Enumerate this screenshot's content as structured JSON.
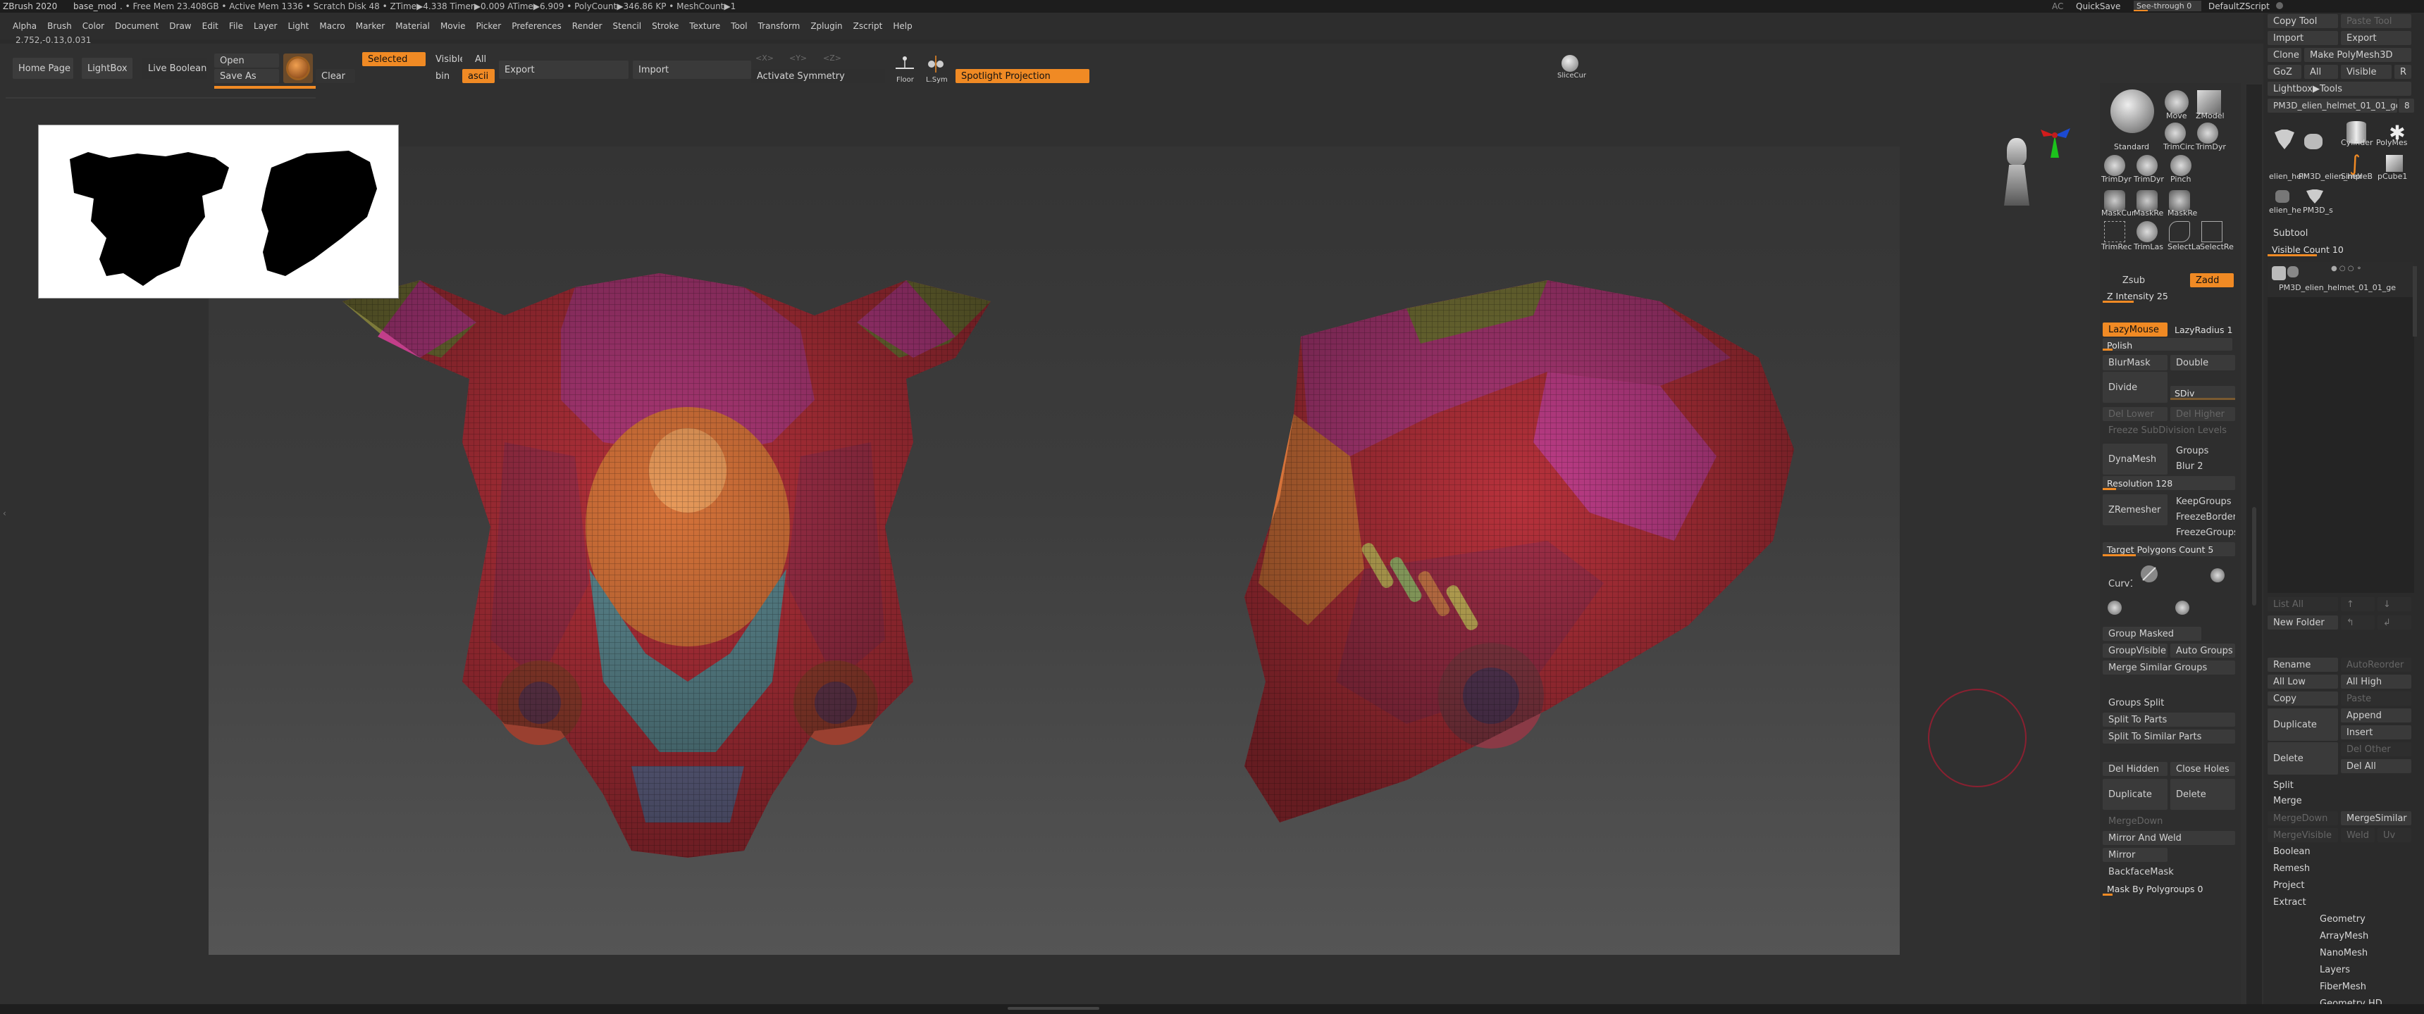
{
  "titlebar": {
    "app_title": "ZBrush 2020",
    "doc_name": "base_mod",
    "stats": ".  • Free Mem 23.408GB • Active Mem 1336 • Scratch Disk 48 •  ZTime▶4.338 Timer▶0.009 ATime▶6.909 • PolyCount▶346.86 KP • MeshCount▶1",
    "ac": "AC",
    "quicksave": "QuickSave",
    "seethrough": "See-through  0",
    "zscript": "DefaultZScript"
  },
  "menus": [
    "Alpha",
    "Brush",
    "Color",
    "Document",
    "Draw",
    "Edit",
    "File",
    "Layer",
    "Light",
    "Macro",
    "Marker",
    "Material",
    "Movie",
    "Picker",
    "Preferences",
    "Render",
    "Stencil",
    "Stroke",
    "Texture",
    "Tool",
    "Transform",
    "Zplugin",
    "Zscript",
    "Help"
  ],
  "coords": "2.752,-0.13,0.031",
  "toolbar": {
    "home": "Home Page",
    "lightbox": "LightBox",
    "live_boolean": "Live Boolean",
    "open": "Open",
    "save_as": "Save As",
    "clear": "Clear",
    "selected": "Selected",
    "visible": "Visible",
    "all": "All",
    "bin": "bin",
    "ascii": "ascii",
    "export": "Export",
    "import": "Import",
    "activate_symmetry": "Activate Symmetry",
    "sym_x": "<X>",
    "sym_y": "<Y>",
    "sym_z": "<Z>",
    "floor": "Floor",
    "l_sym": "L.Sym",
    "spotlight": "Spotlight Projection",
    "slicecurve": "SliceCur"
  },
  "brushes": {
    "standard": "Standard",
    "move": "Move",
    "zmodeler": "ZModel",
    "trimcurve": "TrimCirc",
    "trimdyn": "TrimDyr",
    "trimdyn2": "TrimDyr",
    "trimdyn3": "TrimDyr",
    "pinch": "Pinch",
    "maskcurve": "MaskCur",
    "masklasso": "MaskRe",
    "maskrect": "MaskRe",
    "trimrect": "TrimRec",
    "trimlasso": "TrimLas",
    "selectlasso": "SelectLa",
    "selectrect": "SelectRe",
    "zsub": "Zsub",
    "zadd": "Zadd",
    "z_intensity": "Z Intensity 25",
    "z_intensity_value": 0.25,
    "lazymouse": "LazyMouse",
    "lazyradius": "LazyRadius 1",
    "polish": "Polish",
    "blurmask": "BlurMask",
    "double": "Double",
    "divide": "Divide",
    "sdiv": "SDiv",
    "del_lower": "Del Lower",
    "del_higher": "Del Higher",
    "freeze_subdiv": "Freeze SubDivision Levels",
    "dynamesh": "DynaMesh",
    "groups": "Groups",
    "blur": "Blur 2",
    "resolution": "Resolution 128",
    "resolution_value": 0.1,
    "zremesher": "ZRemesher",
    "keepgroups": "KeepGroups",
    "freezeborder": "FreezeBorder",
    "freezegroups": "FreezeGroups",
    "target_poly": "Target Polygons Count 5",
    "target_value": 0.25,
    "curve": "Curv1",
    "group_masked": "Group Masked",
    "groupvisible": "GroupVisible",
    "auto_groups": "Auto Groups",
    "merge_similar_groups": "Merge Similar Groups",
    "groups_split": "Groups Split",
    "split_to_parts": "Split To Parts",
    "split_to_similar": "Split To Similar Parts",
    "del_hidden": "Del Hidden",
    "close_holes": "Close Holes",
    "duplicate": "Duplicate",
    "delete": "Delete",
    "mergedown": "MergeDown",
    "mirror_weld": "Mirror And Weld",
    "mirror": "Mirror",
    "backfacemask": "BackfaceMask",
    "mask_by_poly": "Mask By Polygroups 0"
  },
  "tool": {
    "copy_tool": "Copy Tool",
    "paste_tool": "Paste Tool",
    "import": "Import",
    "export": "Export",
    "clone": "Clone",
    "make_polymesh": "Make PolyMesh3D",
    "goz": "GoZ",
    "all": "All",
    "visible": "Visible",
    "r": "R",
    "lightbox_tools": "Lightbox▶Tools",
    "current_tool": "PM3D_elien_helmet_01_01_ge",
    "current_num": "8",
    "thumb_cylinder": "Cylinder",
    "thumb_polymesh": "PolyMes",
    "thumb_simpleb": "SimpleB",
    "thumb_pcube": "pCube1",
    "thumb_elien": "elien_helr",
    "thumb_pm3d": "PM3D_elien_helr",
    "thumb_pm3d_small": "PM3D_s",
    "thumb_elien_small": "elien_he",
    "subtool": "Subtool",
    "visible_count": "Visible Count 10",
    "subtool_item": "PM3D_elien_helmet_01_01_ge",
    "list_all": "List All",
    "new_folder": "New Folder",
    "rename": "Rename",
    "autoreorder": "AutoReorder",
    "all_low": "All Low",
    "all_high": "All High",
    "copy": "Copy",
    "paste": "Paste",
    "duplicate": "Duplicate",
    "append": "Append",
    "insert": "Insert",
    "delete": "Delete",
    "del_other": "Del Other",
    "del_all": "Del All",
    "split": "Split",
    "merge": "Merge",
    "mergedown": "MergeDown",
    "mergesimilar": "MergeSimilar",
    "mergevisible": "MergeVisible",
    "weld": "Weld",
    "uv": "Uv",
    "boolean": "Boolean",
    "remesh": "Remesh",
    "project": "Project",
    "extract": "Extract",
    "geometry": "Geometry",
    "arraymesh": "ArrayMesh",
    "nanomesh": "NanoMesh",
    "layers": "Layers",
    "fibermesh": "FiberMesh",
    "geometry_hd": "Geometry HD"
  },
  "colors": {
    "accent": "#f08a24",
    "helmet_red": "#b8323c",
    "helmet_magenta": "#b33a7a",
    "helmet_orange": "#d6733a",
    "helmet_olive": "#7d7a3a",
    "helmet_teal": "#5e8a92"
  }
}
